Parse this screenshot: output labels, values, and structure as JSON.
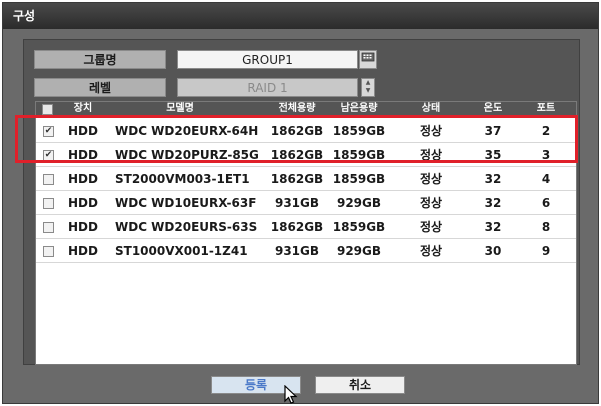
{
  "window": {
    "title": "구성"
  },
  "form": {
    "group_label": "그룹명",
    "group_value": "GROUP1",
    "level_label": "레벨",
    "level_value": "RAID 1"
  },
  "table": {
    "headers": [
      "장치",
      "모델명",
      "전체용량",
      "남은용량",
      "상태",
      "온도",
      "포트"
    ],
    "rows": [
      {
        "checked": true,
        "device": "HDD",
        "model": "WDC WD20EURX-64H",
        "total": "1862GB",
        "free": "1859GB",
        "status": "정상",
        "temp": "37",
        "port": "2"
      },
      {
        "checked": true,
        "device": "HDD",
        "model": "WDC WD20PURZ-85G",
        "total": "1862GB",
        "free": "1859GB",
        "status": "정상",
        "temp": "35",
        "port": "3"
      },
      {
        "checked": false,
        "device": "HDD",
        "model": "ST2000VM003-1ET1",
        "total": "1862GB",
        "free": "1859GB",
        "status": "정상",
        "temp": "32",
        "port": "4"
      },
      {
        "checked": false,
        "device": "HDD",
        "model": "WDC WD10EURX-63F",
        "total": "931GB",
        "free": "929GB",
        "status": "정상",
        "temp": "32",
        "port": "6"
      },
      {
        "checked": false,
        "device": "HDD",
        "model": "WDC WD20EURS-63S",
        "total": "1862GB",
        "free": "1859GB",
        "status": "정상",
        "temp": "32",
        "port": "8"
      },
      {
        "checked": false,
        "device": "HDD",
        "model": "ST1000VX001-1Z41",
        "total": "931GB",
        "free": "929GB",
        "status": "정상",
        "temp": "30",
        "port": "9"
      }
    ]
  },
  "buttons": {
    "register": "등록",
    "cancel": "취소"
  },
  "icons": {
    "keyboard": "keyboard-icon",
    "spinner": "spinner-icon",
    "cursor": "mouse-cursor-icon"
  },
  "colors": {
    "highlight": "#e0202a",
    "ok_text": "#4a78c8"
  }
}
